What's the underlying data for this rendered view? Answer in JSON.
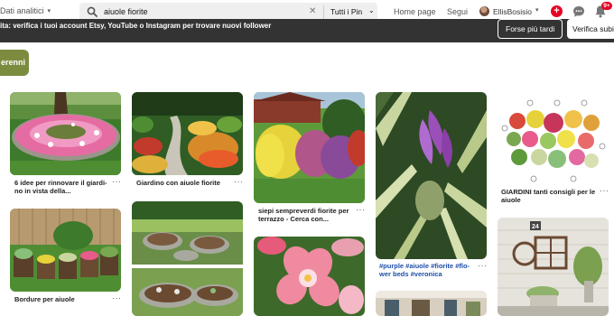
{
  "header": {
    "analytics_label": "Dati analitici",
    "search_query": "aiuole fiorite",
    "search_scope": "Tutti i Pin",
    "nav_home": "Home page",
    "nav_following": "Segui",
    "username": "EllisBosisio",
    "notifications_badge": "9+",
    "colors": {
      "accent": "#e60023",
      "search_bg": "#efefef"
    },
    "icons": [
      "search-icon",
      "clear-icon",
      "chevron-down-icon",
      "plus-icon",
      "chat-icon",
      "bell-icon"
    ]
  },
  "notice": {
    "text": "ita: verifica i tuoi account Etsy, YouTube o Instagram per trovare nuovi follower",
    "later_label": "Forse più tardi",
    "verify_label": "Verifica subito"
  },
  "filter_chip": {
    "label": "erenni",
    "color": "#7b8c3f"
  },
  "pins": [
    {
      "caption": "6 idee per rinnovare il giardi-\nno in vista della...",
      "more": "···"
    },
    {
      "caption": "Giardino con aiuole fiorite",
      "more": "···"
    },
    {
      "caption": "siepi sempreverdi fiorite per\nterrazzo - Cerca con...",
      "more": "···"
    },
    {
      "caption": "#purple #aiuole #fiorite #flo-\nwer beds #veronica",
      "more": "···"
    },
    {
      "caption": "GIARDINI tanti consigli per le\naiuole",
      "more": "···"
    },
    {
      "caption": "Bordure per aiuole",
      "more": "···"
    }
  ]
}
